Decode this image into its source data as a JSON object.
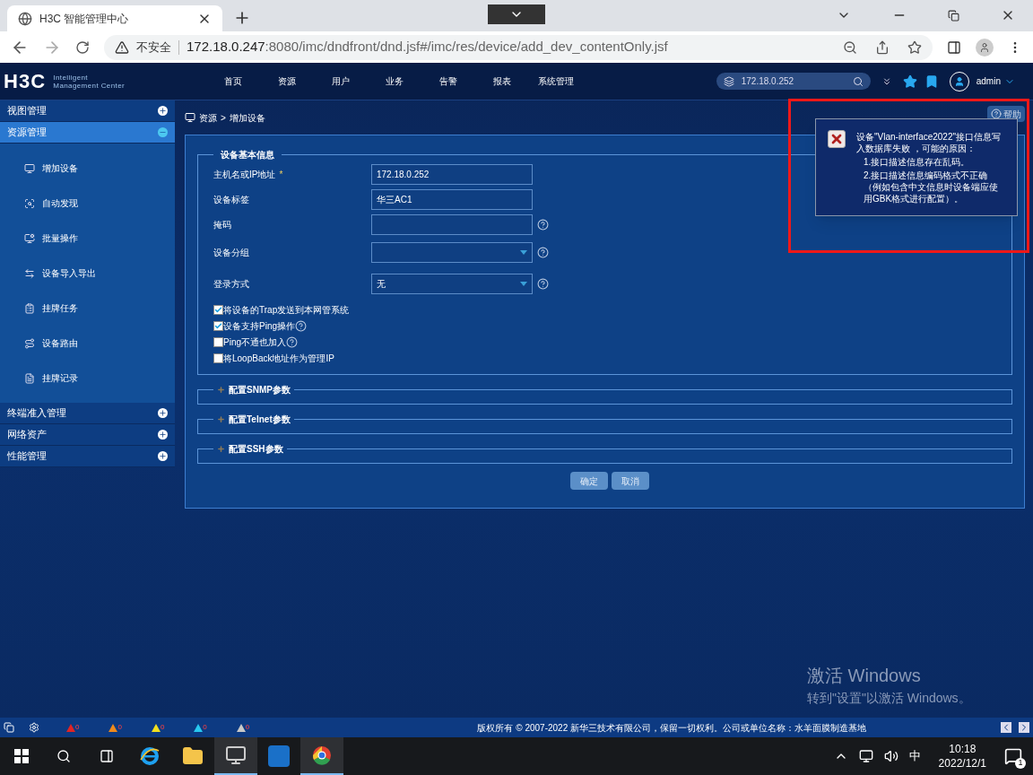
{
  "browser": {
    "tab_title": "H3C 智能管理中心",
    "url_warning": "不安全",
    "url_host": "172.18.0.247",
    "url_rest": ":8080/imc/dndfront/dnd.jsf#/imc/res/device/add_dev_contentOnly.jsf"
  },
  "header": {
    "logo": "H3C",
    "logo_lines": [
      "Intelligent",
      "Management Center"
    ],
    "nav": [
      "首页",
      "资源",
      "用户",
      "业务",
      "告警",
      "报表",
      "系统管理"
    ],
    "search": {
      "value": "172.18.0.252"
    },
    "user": "admin"
  },
  "sidebar": [
    {
      "label": "视图管理",
      "expanded": false,
      "selected": false
    },
    {
      "label": "资源管理",
      "expanded": true,
      "selected": true,
      "children": [
        {
          "label": "增加设备",
          "kind": "add"
        },
        {
          "label": "自动发现",
          "kind": "discover"
        },
        {
          "label": "批量操作",
          "kind": "batch"
        },
        {
          "label": "设备导入导出",
          "kind": "transfer"
        },
        {
          "label": "挂牌任务",
          "kind": "task"
        },
        {
          "label": "设备路由",
          "kind": "route"
        },
        {
          "label": "挂牌记录",
          "kind": "record"
        }
      ]
    },
    {
      "label": "终端准入管理",
      "expanded": false,
      "selected": false
    },
    {
      "label": "网络资产",
      "expanded": false,
      "selected": false
    },
    {
      "label": "性能管理",
      "expanded": false,
      "selected": false
    }
  ],
  "breadcrumb": {
    "items": [
      "资源",
      "增加设备"
    ],
    "separator": ">"
  },
  "help_button": "帮助",
  "form": {
    "legend": "设备基本信息",
    "fields": [
      {
        "label": "主机名或IP地址",
        "required": "*",
        "kind": "text",
        "value": "172.18.0.252",
        "help": false
      },
      {
        "label": "设备标签",
        "kind": "text",
        "value": "华三AC1",
        "help": false
      },
      {
        "label": "掩码",
        "kind": "text",
        "help": true
      },
      {
        "label": "设备分组",
        "kind": "select",
        "help": true
      },
      {
        "label": "登录方式",
        "kind": "select",
        "value": "无",
        "help": true
      }
    ],
    "checkboxes": [
      {
        "label": "将设备的Trap发送到本网管系统",
        "checked": true,
        "help": false
      },
      {
        "label": "设备支持Ping操作",
        "checked": true,
        "help": true
      },
      {
        "label": "Ping不通也加入",
        "checked": false,
        "help": true
      },
      {
        "label": "将LoopBack地址作为管理IP",
        "checked": false,
        "help": false
      }
    ],
    "sections": [
      {
        "label": "配置SNMP参数",
        "expanded": false
      },
      {
        "label": "配置Telnet参数",
        "expanded": false
      },
      {
        "label": "配置SSH参数",
        "expanded": false
      }
    ],
    "buttons": [
      "确定",
      "取消"
    ]
  },
  "error_popup": {
    "lines": [
      "设备\"Vlan-interface2022\"接口信息写入数据库失败 ，可能的原因：",
      "1.接口描述信息存在乱码。",
      "2.接口描述信息编码格式不正确（例如包含中文信息时设备端应使用GBK格式进行配置）。"
    ]
  },
  "status_bar": {
    "alarms": [
      {
        "count": "0",
        "color": "#e02424"
      },
      {
        "count": "0",
        "color": "#f08a1c"
      },
      {
        "count": "0",
        "color": "#f2e01e"
      },
      {
        "count": "0",
        "color": "#28c8f0"
      },
      {
        "count": "0",
        "color": "#c8c8c8"
      }
    ],
    "copyright": "版权所有 © 2007-2022 新华三技术有限公司，保留一切权利。公司或单位名称：水羊面膜制造基地"
  },
  "activation": {
    "title": "激活 Windows",
    "subtitle": "转到\"设置\"以激活 Windows。"
  },
  "taskbar": {
    "ime": "中",
    "time": "10:18",
    "date": "2022/12/1",
    "notifications": "1"
  }
}
